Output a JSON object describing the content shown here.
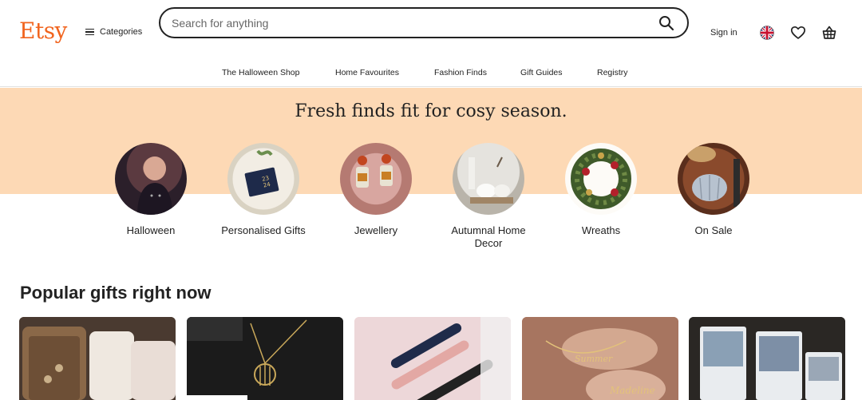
{
  "header": {
    "logo": "Etsy",
    "categories_label": "Categories",
    "search_placeholder": "Search for anything",
    "signin_label": "Sign in"
  },
  "nav": {
    "items": [
      "The Halloween Shop",
      "Home Favourites",
      "Fashion Finds",
      "Gift Guides",
      "Registry"
    ]
  },
  "banner": {
    "title": "Fresh finds fit for cosy season.",
    "categories": [
      {
        "label": "Halloween"
      },
      {
        "label": "Personalised Gifts"
      },
      {
        "label": "Jewellery"
      },
      {
        "label": "Autumnal Home Decor"
      },
      {
        "label": "Wreaths"
      },
      {
        "label": "On Sale"
      }
    ]
  },
  "popular": {
    "title": "Popular gifts right now"
  },
  "colors": {
    "brand": "#F1641E",
    "banner": "#FDD9B5"
  }
}
